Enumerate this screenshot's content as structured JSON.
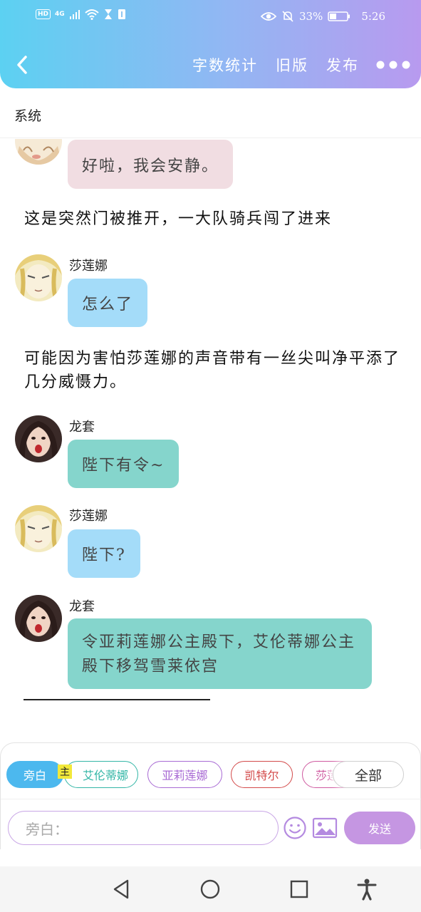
{
  "status_bar": {
    "left_tags": [
      "HD",
      "4G"
    ],
    "battery_percent": "33%",
    "time": "5:26"
  },
  "nav": {
    "word_count": "字数统计",
    "old_version": "旧版",
    "publish": "发布"
  },
  "system_label": "系统",
  "messages": [
    {
      "type": "bubble",
      "speaker": "",
      "text": "好啦，我会安静。"
    },
    {
      "type": "narration",
      "text": "这是突然门被推开，一大队骑兵闯了进来"
    },
    {
      "type": "bubble",
      "speaker": "莎莲娜",
      "text": "怎么了"
    },
    {
      "type": "narration",
      "text": "可能因为害怕莎莲娜的声音带有一丝尖叫净平添了几分威慑力。"
    },
    {
      "type": "bubble",
      "speaker": "龙套",
      "text": "陛下有令~"
    },
    {
      "type": "bubble",
      "speaker": "莎莲娜",
      "text": "陛下?"
    },
    {
      "type": "bubble",
      "speaker": "龙套",
      "text": "令亚莉莲娜公主殿下，艾伦蒂娜公主殿下移驾雪莱依宫"
    }
  ],
  "composer": {
    "chips": {
      "narrator": "旁白",
      "main_badge": "主",
      "ailunti": "艾伦蒂娜",
      "yali": "亚莉莲娜",
      "kaiter": "凯特尔",
      "shalian": "莎莲",
      "all": "全部"
    },
    "input_placeholder": "旁白：",
    "send": "发送"
  },
  "colors": {
    "header_gradient_start": "#5cd1f2",
    "header_gradient_end": "#b89aef",
    "bubble_pink": "#f1dde2",
    "bubble_blue": "#a4dcf9",
    "bubble_teal": "#85d5cc",
    "send_button": "#c596e2"
  }
}
